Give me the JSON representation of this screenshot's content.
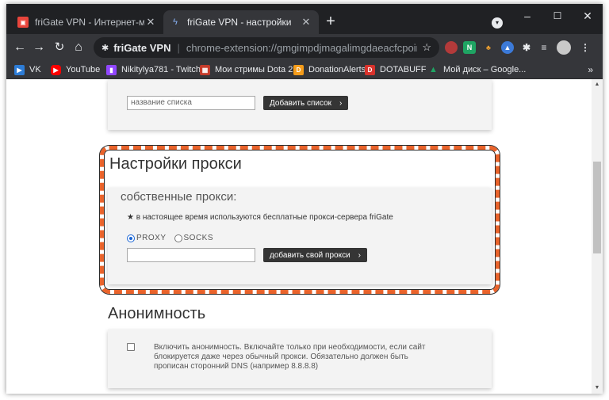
{
  "browser": {
    "tabs": [
      {
        "title": "friGate VPN - Интернет-магазин",
        "active": false
      },
      {
        "title": "friGate VPN - настройки",
        "active": true
      }
    ],
    "newtab_glyph": "+",
    "window_controls": {
      "minimize": "–",
      "maximize": "☐",
      "close": "✕"
    },
    "omnibox": {
      "site_name": "friGate VPN",
      "separator": "|",
      "url": "chrome-extension://gmgimpdjmagalimgdaeacfcpoimfpikm..."
    },
    "bookmarks": [
      {
        "label": "VK",
        "color": "#2d7cd6",
        "glyph": "▶"
      },
      {
        "label": "YouTube",
        "color": "#ff0000",
        "glyph": "▶"
      },
      {
        "label": "Nikitylya781 - Twitch",
        "color": "#9147ff",
        "glyph": "▮"
      },
      {
        "label": "Мои стримы Dota 2",
        "color": "#c43b2b",
        "glyph": "▦"
      },
      {
        "label": "DonationAlerts",
        "color": "#f59c1a",
        "glyph": "D"
      },
      {
        "label": "DOTABUFF",
        "color": "#d9322c",
        "glyph": "D"
      },
      {
        "label": "Мой диск – Google...",
        "color": "#1fa463",
        "glyph": "▲"
      }
    ],
    "bookmarks_more": "»"
  },
  "page": {
    "list_card": {
      "input_placeholder": "название списка",
      "add_button": "Добавить список"
    },
    "proxy": {
      "heading": "Настройки прокси",
      "subheading": "собственные прокси:",
      "note_bullet": "★",
      "note": "в настоящее время используются бесплатные прокси-сервера friGate",
      "radio_proxy": "PROXY",
      "radio_socks": "SOCKS",
      "selected": "PROXY",
      "add_button": "добавить свой прокси"
    },
    "anonymity": {
      "heading": "Анонимность",
      "text_line1": "Включить анонимность. Включайте только при необходимости, если сайт",
      "text_line2": "блокируется даже через обычный прокси. Обязательно должен быть",
      "text_line3": "прописан сторонний DNS (например 8.8.8.8)",
      "checked": false
    },
    "chevron": "›"
  },
  "colors": {
    "highlight": "#e9632b",
    "button_dark": "#353535",
    "chrome_dark": "#202124"
  }
}
